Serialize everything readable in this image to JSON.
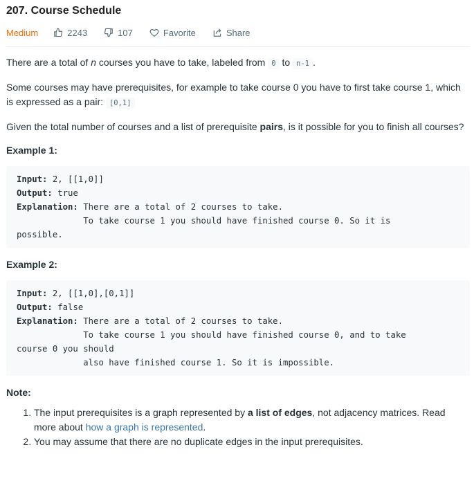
{
  "problem": {
    "title": "207. Course Schedule",
    "difficulty": "Medium",
    "likes": "2243",
    "dislikes": "107",
    "favorite_label": "Favorite",
    "share_label": "Share"
  },
  "description": {
    "p1_a": "There are a total of ",
    "p1_n": "n",
    "p1_b": " courses you have to take, labeled from ",
    "p1_code1": "0",
    "p1_c": " to ",
    "p1_code2": "n-1",
    "p1_d": ".",
    "p2_a": "Some courses may have prerequisites, for example to take course 0 you have to first take course 1, which is expressed as a pair: ",
    "p2_code": "[0,1]",
    "p3_a": "Given the total number of courses and a list of prerequisite ",
    "p3_bold": "pairs",
    "p3_b": ", is it possible for you to finish all courses?"
  },
  "examples": [
    {
      "title": "Example 1:",
      "input_label": "Input:",
      "input": " 2, [[1,0]]",
      "output_label": "Output:",
      "output": " true",
      "explanation_label": "Explanation:",
      "explanation": " There are a total of 2 courses to take.\n             To take course 1 you should have finished course 0. So it is\npossible."
    },
    {
      "title": "Example 2:",
      "input_label": "Input:",
      "input": " 2, [[1,0],[0,1]]",
      "output_label": "Output:",
      "output": " false",
      "explanation_label": "Explanation:",
      "explanation": " There are a total of 2 courses to take.\n             To take course 1 you should have finished course 0, and to take\ncourse 0 you should\n             also have finished course 1. So it is impossible."
    }
  ],
  "note": {
    "title": "Note:",
    "item1_a": "The input prerequisites is a graph represented by ",
    "item1_bold": "a list of edges",
    "item1_b": ", not adjacency matrices. Read more about ",
    "item1_link": "how a graph is represented",
    "item1_c": ".",
    "item2": "You may assume that there are no duplicate edges in the input prerequisites."
  },
  "icons": {
    "like": "thumbs-up-icon",
    "dislike": "thumbs-down-icon",
    "favorite": "heart-icon",
    "share": "share-icon"
  },
  "colors": {
    "difficulty": "#ef6c00",
    "text": "#263238",
    "muted": "#546e7a",
    "code_bg": "#f7f9fa",
    "link": "#3a78a8"
  }
}
